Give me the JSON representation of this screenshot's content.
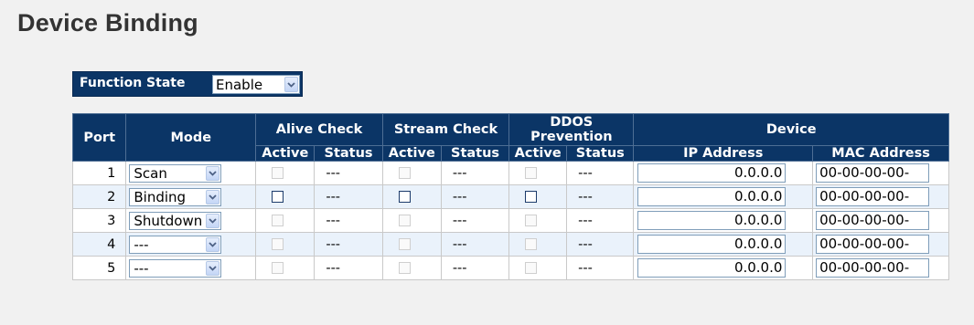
{
  "page": {
    "title": "Device Binding"
  },
  "function_state": {
    "label": "Function State",
    "value": "Enable"
  },
  "table": {
    "headers": {
      "port": "Port",
      "mode": "Mode",
      "alive_check": "Alive Check",
      "stream_check": "Stream Check",
      "ddos_line1": "DDOS",
      "ddos_line2": "Prevention",
      "device": "Device",
      "active": "Active",
      "status": "Status",
      "ip_address": "IP Address",
      "mac_address": "MAC Address"
    },
    "rows": [
      {
        "port": "1",
        "mode": "Scan",
        "alive_status": "---",
        "stream_status": "---",
        "ddos_status": "---",
        "ip": "0.0.0.0",
        "mac": "00-00-00-00-",
        "enabled": false
      },
      {
        "port": "2",
        "mode": "Binding",
        "alive_status": "---",
        "stream_status": "---",
        "ddos_status": "---",
        "ip": "0.0.0.0",
        "mac": "00-00-00-00-",
        "enabled": true
      },
      {
        "port": "3",
        "mode": "Shutdown",
        "alive_status": "---",
        "stream_status": "---",
        "ddos_status": "---",
        "ip": "0.0.0.0",
        "mac": "00-00-00-00-",
        "enabled": false
      },
      {
        "port": "4",
        "mode": "---",
        "alive_status": "---",
        "stream_status": "---",
        "ddos_status": "---",
        "ip": "0.0.0.0",
        "mac": "00-00-00-00-",
        "enabled": false
      },
      {
        "port": "5",
        "mode": "---",
        "alive_status": "---",
        "stream_status": "---",
        "ddos_status": "---",
        "ip": "0.0.0.0",
        "mac": "00-00-00-00-",
        "enabled": false
      }
    ]
  },
  "icons": {
    "select_arrow": "chevron-down-icon"
  },
  "colors": {
    "header_bg": "#0b3566",
    "row_alt_bg": "#eaf2fb",
    "page_bg": "#f1f1f1"
  }
}
